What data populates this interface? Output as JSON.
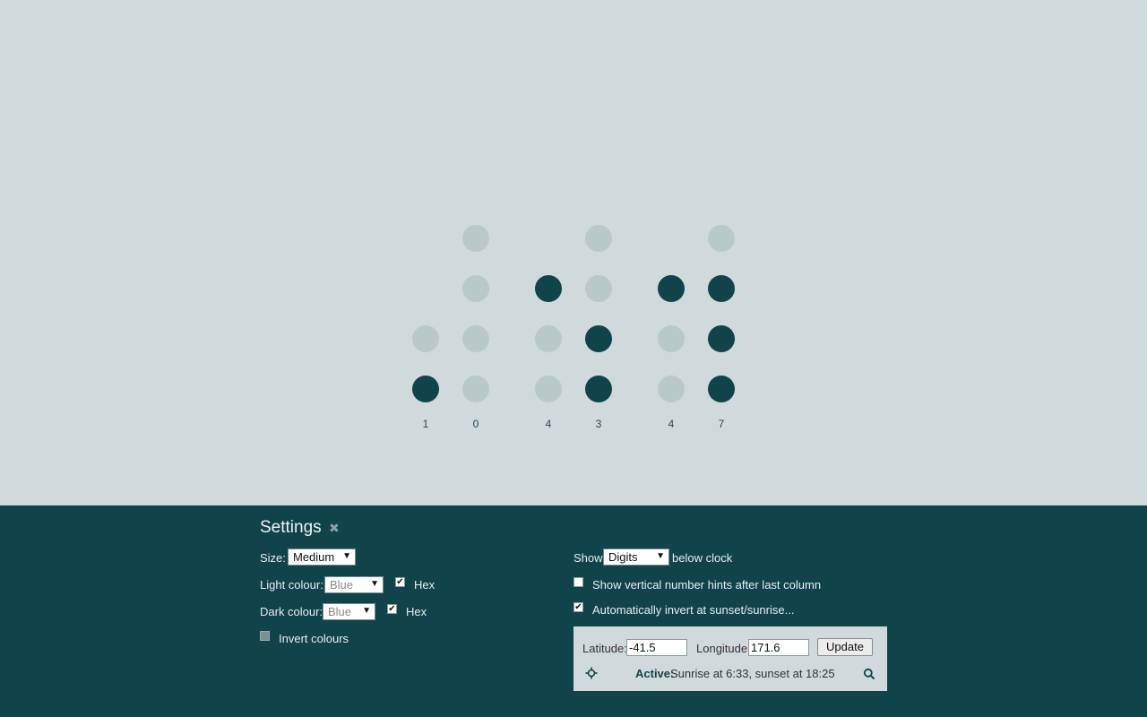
{
  "clock": {
    "columns": [
      {
        "digit": "1",
        "bits": [
          0,
          0,
          0,
          1
        ],
        "rows_shown": 2
      },
      {
        "digit": "0",
        "bits": [
          0,
          0,
          0,
          0
        ],
        "rows_shown": 4
      },
      {
        "digit": "4",
        "bits": [
          0,
          1,
          0,
          0
        ],
        "rows_shown": 3
      },
      {
        "digit": "3",
        "bits": [
          0,
          0,
          1,
          1
        ],
        "rows_shown": 4
      },
      {
        "digit": "4",
        "bits": [
          0,
          1,
          0,
          0
        ],
        "rows_shown": 3
      },
      {
        "digit": "7",
        "bits": [
          0,
          1,
          1,
          1
        ],
        "rows_shown": 4
      }
    ],
    "colors": {
      "on": "#10434a",
      "off": "#b9c9c9",
      "background": "#d0d9db"
    }
  },
  "settings": {
    "title": "Settings",
    "close_icon": "close-x-icon",
    "size": {
      "label": "Size:",
      "value": "Medium"
    },
    "light_colour": {
      "label": "Light colour:",
      "value": "Blue",
      "hex_label": "Hex",
      "hex_checked": true
    },
    "dark_colour": {
      "label": "Dark colour:",
      "value": "Blue",
      "hex_label": "Hex",
      "hex_checked": true
    },
    "invert": {
      "label": "Invert colours",
      "checked": false
    },
    "show": {
      "label_before": "Show",
      "value": "Digits",
      "label_after": "below clock"
    },
    "vertical_hints": {
      "label": "Show vertical number hints after last column",
      "checked": false
    },
    "auto_invert": {
      "label": "Automatically invert at sunset/sunrise...",
      "checked": true
    },
    "geo": {
      "latitude_label": "Latitude:",
      "latitude_value": "-41.5",
      "longitude_label": "Longitude:",
      "longitude_value": "171.6",
      "update_label": "Update",
      "status_label": "Active:",
      "status_text": "Sunrise at 6:33, sunset at 18:25",
      "locate_icon": "crosshair-icon",
      "search_icon": "search-icon"
    },
    "panel_color": "#10434a"
  }
}
